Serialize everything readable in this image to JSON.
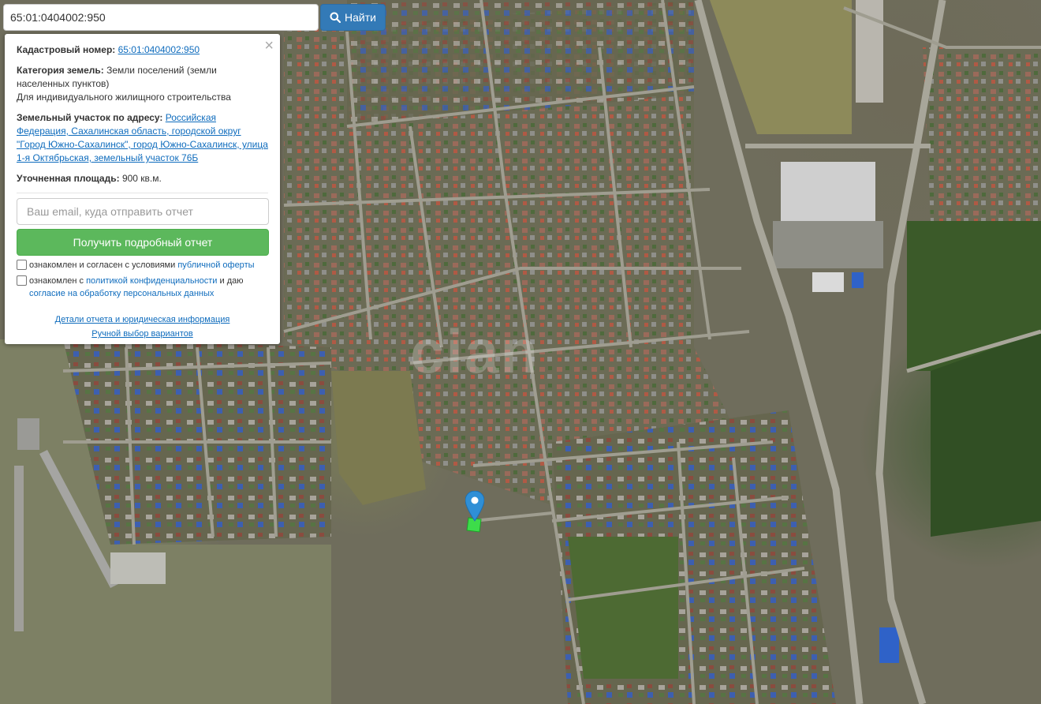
{
  "search": {
    "value": "65:01:0404002:950",
    "button_label": "Найти",
    "button_icon": "search-icon"
  },
  "panel": {
    "close_symbol": "×",
    "cadastral_label": "Кадастровый номер:",
    "cadastral_value": "65:01:0404002:950",
    "category_label": "Категория земель:",
    "category_value": "Земли поселений (земли населенных пунктов)",
    "usage": "Для индивидуального жилищного строительства",
    "address_label": "Земельный участок по адресу:",
    "address_value": "Российская Федерация, Сахалинская область, городской округ \"Город Южно-Сахалинск\", город Южно-Сахалинск, улица 1-я Октябрьская, земельный участок 76Б",
    "area_label": "Уточненная площадь:",
    "area_value": "900 кв.м.",
    "email_placeholder": "Ваш email, куда отправить отчет",
    "report_button": "Получить подробный отчет",
    "consent1_text": "ознакомлен и согласен с условиями",
    "consent1_link": "публичной оферты",
    "consent2_text": "ознакомлен с",
    "consent2_link": "политикой конфиденциальности",
    "consent2_mid": "и даю",
    "consent2_link2": "согласие на обработку персональных данных",
    "link_details": "Детали отчета и юридическая информация",
    "link_manual": "Ручной выбор вариантов"
  },
  "map": {
    "watermark": "cian",
    "marker_icon": "map-pin-icon",
    "parcel_color": "#3ddc4a",
    "marker_color": "#2f8fd6"
  }
}
